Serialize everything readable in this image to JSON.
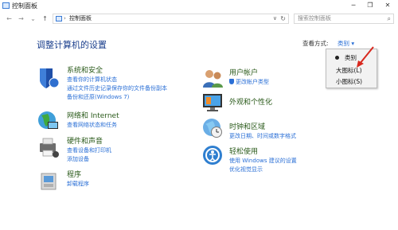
{
  "window": {
    "title": "控制面板"
  },
  "address": {
    "separator": "›",
    "path": "控制面板",
    "dropdown": "∨",
    "search_placeholder": "搜索控制面板"
  },
  "view": {
    "label": "查看方式:",
    "selected": "类别 ▾"
  },
  "menu": {
    "items": [
      "类别",
      "大图标(L)",
      "小图标(S)"
    ]
  },
  "main": {
    "title": "调整计算机的设置"
  },
  "categories": {
    "system": {
      "title": "系统和安全",
      "links": [
        "查看你的计算机状态",
        "通过文件历史记录保存你的文件备份副本",
        "备份和还原(Windows 7)"
      ]
    },
    "network": {
      "title": "网络和 Internet",
      "links": [
        "查看网络状态和任务"
      ]
    },
    "hardware": {
      "title": "硬件和声音",
      "links": [
        "查看设备和打印机",
        "添加设备"
      ]
    },
    "programs": {
      "title": "程序",
      "links": [
        "卸载程序"
      ]
    },
    "user": {
      "title": "用户帐户",
      "links": [
        "更改帐户类型"
      ]
    },
    "appearance": {
      "title": "外观和个性化"
    },
    "clock": {
      "title": "时钟和区域",
      "links": [
        "更改日期、时间或数字格式"
      ]
    },
    "ease": {
      "title": "轻松使用",
      "links": [
        "使用 Windows 建议的设置",
        "优化视觉显示"
      ]
    }
  },
  "colors": {
    "accent": "#2a6fd6",
    "title_blue": "#1a3e8c",
    "category_green": "#2a5a1a",
    "arrow_red": "#d8281e"
  }
}
